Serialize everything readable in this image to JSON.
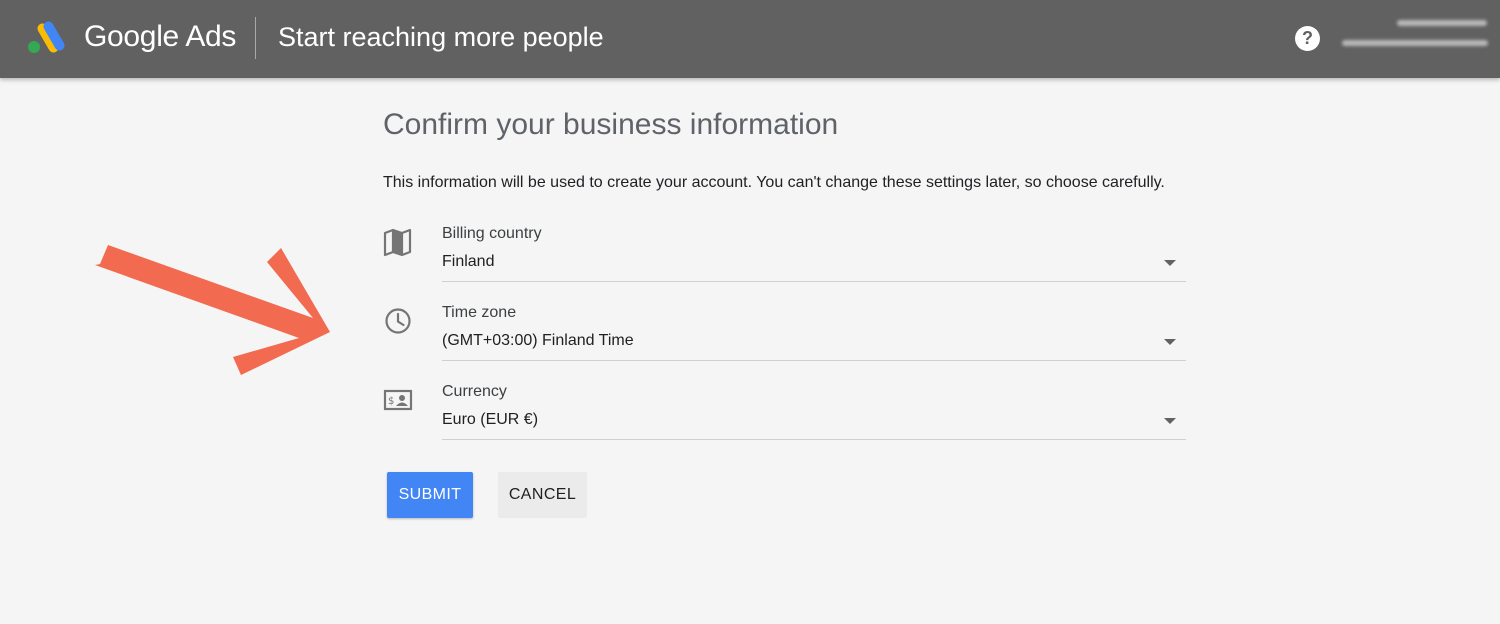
{
  "header": {
    "brand": "Google Ads",
    "headline": "Start reaching more people",
    "help_icon": "help-circle-icon",
    "help_glyph": "?"
  },
  "page": {
    "title": "Confirm your business information",
    "subtitle": "This information will be used to create your account. You can't change these settings later, so choose carefully."
  },
  "fields": [
    {
      "icon": "map-icon",
      "label": "Billing country",
      "value": "Finland"
    },
    {
      "icon": "clock-icon",
      "label": "Time zone",
      "value": "(GMT+03:00) Finland Time"
    },
    {
      "icon": "currency-icon",
      "label": "Currency",
      "value": "Euro (EUR €)"
    }
  ],
  "actions": {
    "submit_label": "SUBMIT",
    "cancel_label": "CANCEL"
  },
  "colors": {
    "header_bg": "#616161",
    "primary": "#4285f4",
    "arrow": "#f26a4f"
  }
}
